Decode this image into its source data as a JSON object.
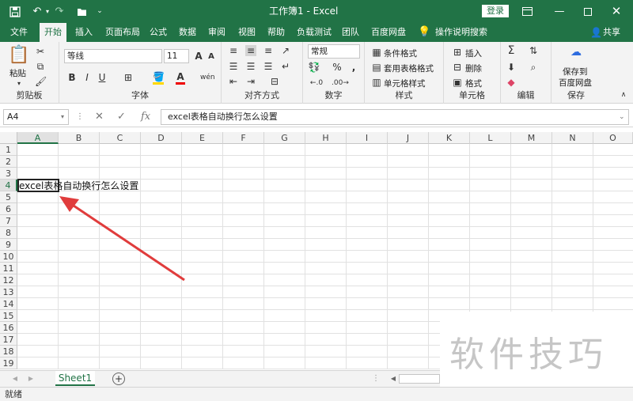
{
  "titlebar": {
    "title": "工作簿1 - Excel",
    "login": "登录",
    "icons": [
      "save-icon",
      "undo-icon",
      "redo-icon",
      "open-icon",
      "customize-icon",
      "ribbon-options-icon",
      "minimize-icon",
      "maximize-icon",
      "close-icon"
    ]
  },
  "menu": {
    "items": [
      "文件",
      "开始",
      "插入",
      "页面布局",
      "公式",
      "数据",
      "审阅",
      "视图",
      "帮助",
      "负载测试",
      "团队",
      "百度网盘",
      "操作说明搜索"
    ],
    "active": "开始",
    "share": "共享"
  },
  "ribbon": {
    "clipboard": {
      "label": "剪贴板",
      "paste": "粘贴"
    },
    "font": {
      "label": "字体",
      "name": "等线",
      "size": "11",
      "grow": "A",
      "shrink": "A",
      "bold": "B",
      "italic": "I",
      "underline": "U",
      "color": "A",
      "phonetic": "wén"
    },
    "alignment": {
      "label": "对齐方式"
    },
    "number": {
      "label": "数字",
      "format": "常规",
      "percent": "%",
      "comma": ","
    },
    "styles": {
      "label": "样式",
      "conditional": "条件格式",
      "table": "套用表格格式",
      "cell": "单元格样式"
    },
    "cells": {
      "label": "单元格",
      "insert": "插入",
      "delete": "删除",
      "format": "格式"
    },
    "editing": {
      "label": "编辑"
    },
    "save": {
      "label": "保存",
      "button": "保存到\n百度网盘",
      "line1": "保存到",
      "line2": "百度网盘"
    }
  },
  "formula_bar": {
    "name_box": "A4",
    "value": "excel表格自动换行怎么设置",
    "fx": "fx"
  },
  "columns": [
    "A",
    "B",
    "C",
    "D",
    "E",
    "F",
    "G",
    "H",
    "I",
    "J",
    "K",
    "L",
    "M",
    "N",
    "O"
  ],
  "rows": [
    "1",
    "2",
    "3",
    "4",
    "5",
    "6",
    "7",
    "8",
    "9",
    "10",
    "11",
    "12",
    "13",
    "14",
    "15",
    "16",
    "17",
    "18",
    "19"
  ],
  "active_cell": "A4",
  "cell_a4_text": "excel表格自动换行怎么设置",
  "sheets": [
    "Sheet1"
  ],
  "status": "就绪",
  "watermark": "软件技巧",
  "colors": {
    "brand": "#217346",
    "arrow": "#e03c3c"
  }
}
